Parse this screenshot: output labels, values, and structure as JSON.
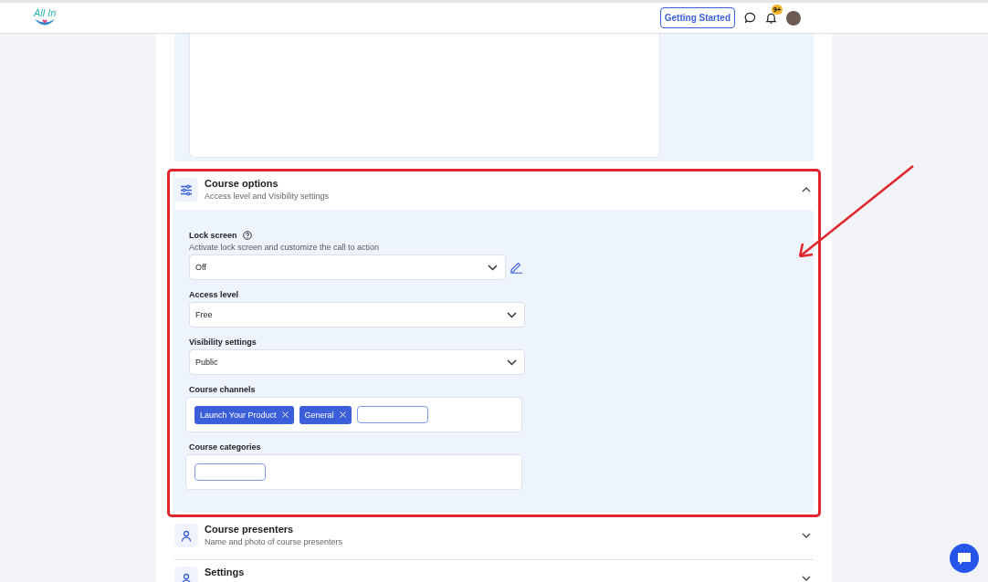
{
  "header": {
    "logo_text": "All In",
    "getting_started": "Getting Started",
    "notification_badge": "9+"
  },
  "sections": [
    {
      "kind": "options",
      "title": "Course options",
      "subtitle": "Access level and Visibility settings",
      "expanded": true,
      "highlighted": true,
      "fields": [
        {
          "kind": "select",
          "label": "Lock screen",
          "help": true,
          "description": "Activate lock screen and customize the call to action",
          "value": "Off",
          "editable": true
        },
        {
          "kind": "select",
          "label": "Access level",
          "value": "Free"
        },
        {
          "kind": "select",
          "label": "Visibility settings",
          "value": "Public"
        },
        {
          "kind": "tags",
          "label": "Course channels",
          "tags": [
            "Launch Your Product",
            "General"
          ]
        },
        {
          "kind": "tags",
          "label": "Course categories"
        }
      ]
    },
    {
      "kind": "presenters",
      "title": "Course presenters",
      "subtitle": "Name and photo of course presenters",
      "expanded": false,
      "highlighted": false
    },
    {
      "kind": "settings",
      "title": "Settings",
      "expanded": false,
      "highlighted": false
    }
  ]
}
